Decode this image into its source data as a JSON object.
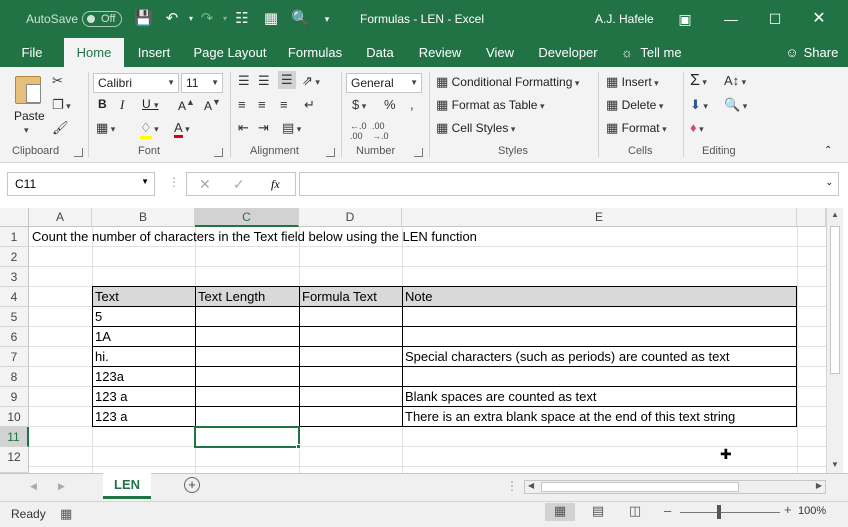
{
  "titlebar": {
    "autosave_label": "AutoSave",
    "autosave_state": "Off",
    "title": "Formulas - LEN  -  Excel",
    "user": "A.J. Hafele"
  },
  "tabs": [
    "File",
    "Home",
    "Insert",
    "Page Layout",
    "Formulas",
    "Data",
    "Review",
    "View",
    "Developer"
  ],
  "tell_me": "Tell me",
  "share": "Share",
  "ribbon": {
    "groups": {
      "clipboard": "Clipboard",
      "font": "Font",
      "alignment": "Alignment",
      "number": "Number",
      "styles": "Styles",
      "cells": "Cells",
      "editing": "Editing"
    },
    "paste": "Paste",
    "font_name": "Calibri",
    "font_size": "11",
    "number_format": "General",
    "conditional_formatting": "Conditional Formatting",
    "format_as_table": "Format as Table",
    "cell_styles": "Cell Styles",
    "insert": "Insert",
    "delete": "Delete",
    "format": "Format"
  },
  "formula_bar": {
    "name_box": "C11",
    "fx": "fx",
    "value": ""
  },
  "columns": [
    "A",
    "B",
    "C",
    "D",
    "E"
  ],
  "rows": [
    "1",
    "2",
    "3",
    "4",
    "5",
    "6",
    "7",
    "8",
    "9",
    "10",
    "11",
    "12"
  ],
  "cells": {
    "a1": "Count the number of characters in the Text field below using the LEN function",
    "headers": [
      "Text",
      "Text Length",
      "Formula Text",
      "Note"
    ],
    "text_values": [
      "5",
      "1A",
      "hi.",
      "123a",
      "123 a",
      "123 a"
    ],
    "notes": [
      "",
      "",
      "Special characters (such as periods) are counted as text",
      "",
      "Blank spaces are counted as text",
      "There is an extra blank space at the end of this text string"
    ]
  },
  "sheet_tab": "LEN",
  "status": {
    "ready": "Ready",
    "zoom": "100%"
  }
}
